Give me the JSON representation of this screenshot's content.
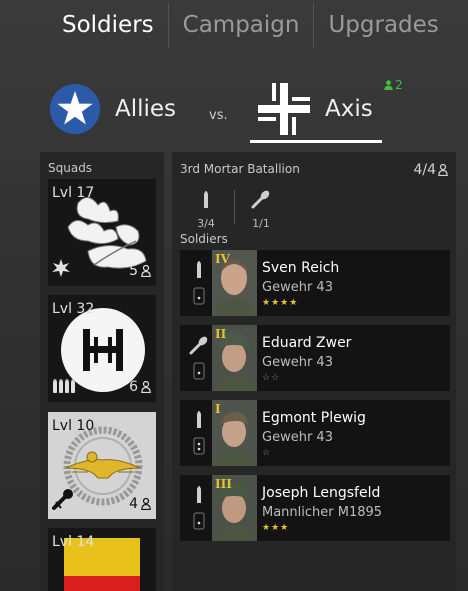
{
  "tabs": [
    {
      "label": "Soldiers",
      "active": true
    },
    {
      "label": "Campaign",
      "active": false
    },
    {
      "label": "Upgrades",
      "active": false
    }
  ],
  "matchup": {
    "allies": {
      "name": "Allies",
      "icon": "allies-star-roundel-icon"
    },
    "vs": "vs.",
    "axis": {
      "name": "Axis",
      "icon": "axis-balkenkreuz-icon",
      "online_count": "2"
    }
  },
  "squads": {
    "title": "Squads",
    "items": [
      {
        "level": "Lvl 17",
        "count": "5",
        "type_icon": "explosion-icon",
        "emblem": "oak-leaves-emblem",
        "selected": false
      },
      {
        "level": "Lvl 32",
        "count": "6",
        "type_icon": "ammo-icon",
        "emblem": "h-roundel-emblem",
        "selected": false
      },
      {
        "level": "Lvl 10",
        "count": "4",
        "type_icon": "mortar-icon",
        "emblem": "eagle-wreath-emblem",
        "selected": true
      },
      {
        "level": "Lvl 14",
        "count": "",
        "type_icon": "",
        "emblem": "flag-emblem",
        "selected": false
      }
    ]
  },
  "battalion": {
    "title": "3rd  Mortar Batallion",
    "count": "4/4",
    "slots": [
      {
        "icon": "rifle-ammo-icon",
        "value": "3/4"
      },
      {
        "icon": "mortar-shell-icon",
        "value": "1/1"
      }
    ],
    "soldiers_label": "Soldiers",
    "soldiers": [
      {
        "rank": "IV",
        "name": "Sven Reich",
        "weapon": "Gewehr 43",
        "stars": "★★★★",
        "star_color": "#e6c32c",
        "role_icon": "rifle-ammo-icon",
        "helmet": false
      },
      {
        "rank": "II",
        "name": "Eduard Zwer",
        "weapon": "Gewehr 43",
        "stars": "☆☆",
        "star_color": "#8a8a8a",
        "role_icon": "mortar-shell-icon",
        "helmet": true
      },
      {
        "rank": "I",
        "name": "Egmont Plewig",
        "weapon": "Gewehr 43",
        "stars": "☆",
        "star_color": "#8a8a8a",
        "role_icon": "rifle-ammo-icon",
        "helmet": false
      },
      {
        "rank": "III",
        "name": "Joseph Lengsfeld",
        "weapon": "Mannlicher M1895",
        "stars": "★★★",
        "star_color": "#e6c32c",
        "role_icon": "rifle-ammo-icon",
        "helmet": true
      }
    ]
  }
}
